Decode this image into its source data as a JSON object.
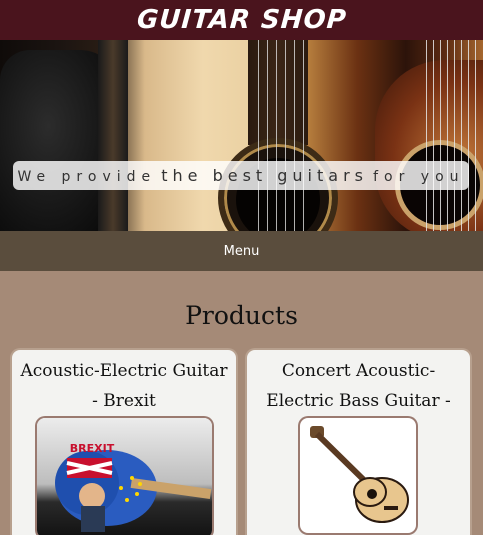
{
  "header": {
    "title": "GUITAR SHOP"
  },
  "hero": {
    "tagline_small_1": "We provide",
    "tagline_big": "the best guitars",
    "tagline_small_2": "for you"
  },
  "nav": {
    "menu_label": "Menu"
  },
  "products": {
    "heading": "Products",
    "items": [
      {
        "title": "Acoustic-Electric Guitar - Brexit",
        "image_alt": "Brexit guitar"
      },
      {
        "title": "Concert Acoustic-Electric Bass Guitar - Natural",
        "image_alt": "Natural bass guitar"
      }
    ]
  },
  "colors": {
    "header_bg": "#4a141d",
    "menu_bg": "#5a4d3d",
    "page_bg": "#a58a77",
    "card_bg": "#f3f3f1"
  }
}
